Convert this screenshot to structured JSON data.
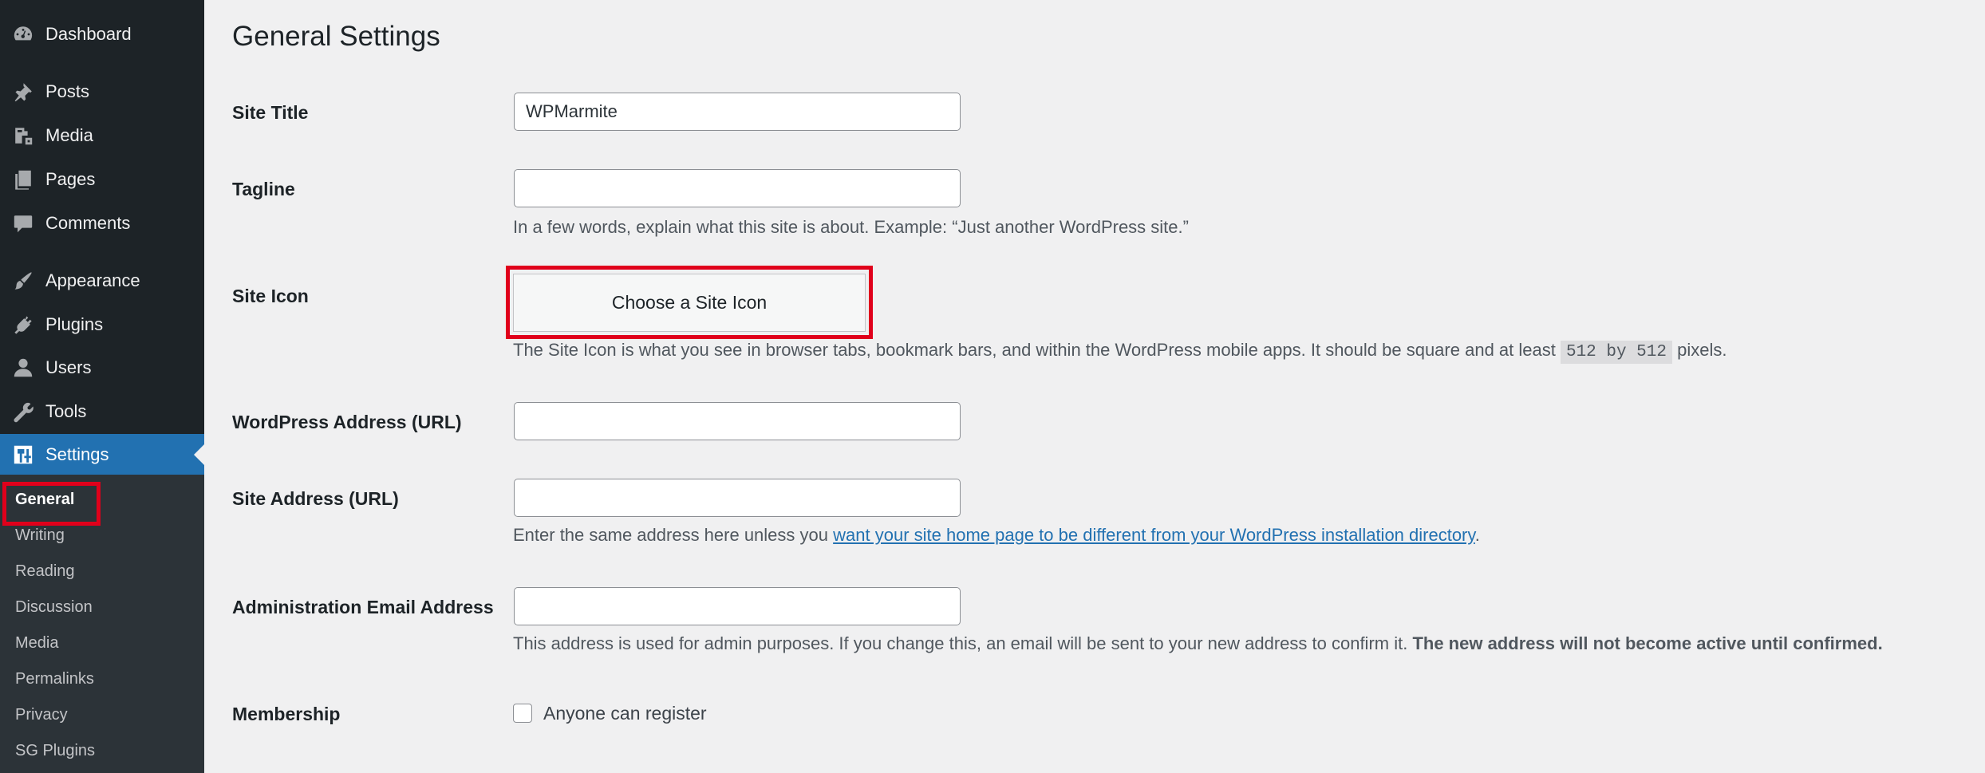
{
  "sidebar": {
    "items": [
      {
        "label": "Dashboard",
        "icon": "dashboard-icon"
      },
      {
        "label": "Posts",
        "icon": "pushpin-icon"
      },
      {
        "label": "Media",
        "icon": "media-icon"
      },
      {
        "label": "Pages",
        "icon": "pages-icon"
      },
      {
        "label": "Comments",
        "icon": "comment-icon"
      },
      {
        "label": "Appearance",
        "icon": "paintbrush-icon"
      },
      {
        "label": "Plugins",
        "icon": "plug-icon"
      },
      {
        "label": "Users",
        "icon": "user-icon"
      },
      {
        "label": "Tools",
        "icon": "wrench-icon"
      },
      {
        "label": "Settings",
        "icon": "settings-icon"
      }
    ],
    "submenu": [
      "General",
      "Writing",
      "Reading",
      "Discussion",
      "Media",
      "Permalinks",
      "Privacy",
      "SG Plugins"
    ],
    "active_color": "#2271b1"
  },
  "page": {
    "title": "General Settings",
    "site_title": {
      "label": "Site Title",
      "value": "WPMarmite"
    },
    "tagline": {
      "label": "Tagline",
      "value": "",
      "description": "In a few words, explain what this site is about. Example: “Just another WordPress site.”"
    },
    "site_icon": {
      "label": "Site Icon",
      "button": "Choose a Site Icon",
      "description_before": "The Site Icon is what you see in browser tabs, bookmark bars, and within the WordPress mobile apps. It should be square and at least",
      "code": "512 by 512",
      "description_after": "pixels."
    },
    "wp_address": {
      "label": "WordPress Address (URL)",
      "value": ""
    },
    "site_address": {
      "label": "Site Address (URL)",
      "value": "",
      "description_before": "Enter the same address here unless you",
      "link": "want your site home page to be different from your WordPress installation directory",
      "description_after": "."
    },
    "admin_email": {
      "label": "Administration Email Address",
      "value": "",
      "description": "This address is used for admin purposes. If you change this, an email will be sent to your new address to confirm it.",
      "description_bold": "The new address will not become active until confirmed."
    },
    "membership": {
      "label": "Membership",
      "checkbox_label": "Anyone can register",
      "checked": false
    }
  },
  "highlight_color": "#e0001b"
}
